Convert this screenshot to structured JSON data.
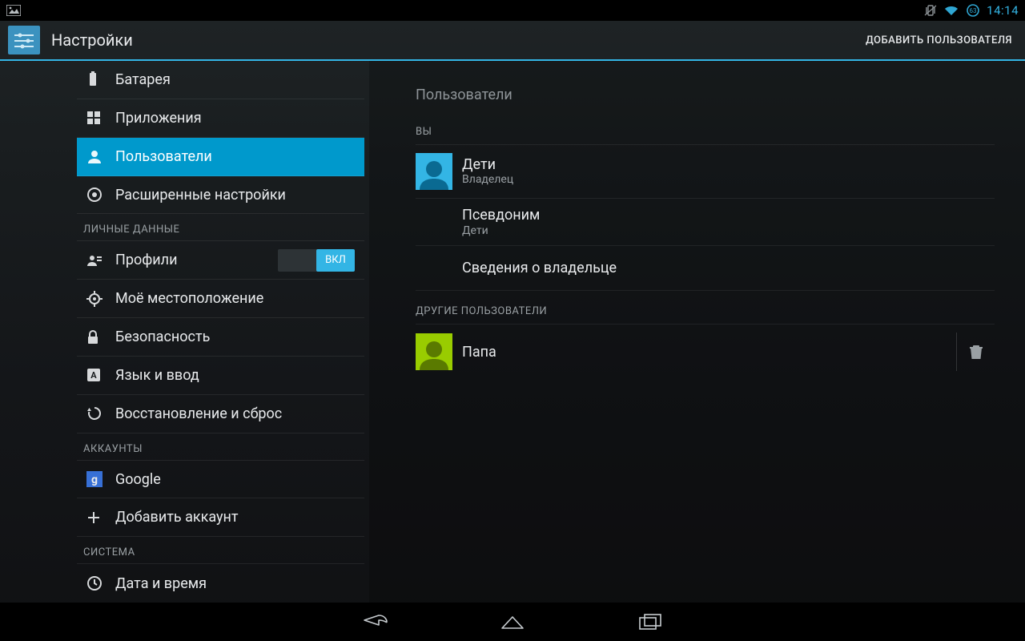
{
  "statusbar": {
    "time": "14:14"
  },
  "appbar": {
    "title": "Настройки",
    "action": "ДОБАВИТЬ ПОЛЬЗОВАТЕЛЯ"
  },
  "sidebar": {
    "items": [
      {
        "label": "Батарея"
      },
      {
        "label": "Приложения"
      },
      {
        "label": "Пользователи"
      },
      {
        "label": "Расширенные настройки"
      }
    ],
    "personal_header": "ЛИЧНЫЕ ДАННЫЕ",
    "personal": [
      {
        "label": "Профили",
        "switch": "ВКЛ"
      },
      {
        "label": "Моё местоположение"
      },
      {
        "label": "Безопасность"
      },
      {
        "label": "Язык и ввод"
      },
      {
        "label": "Восстановление и сброс"
      }
    ],
    "accounts_header": "АККАУНТЫ",
    "accounts": [
      {
        "label": "Google"
      },
      {
        "label": "Добавить аккаунт"
      }
    ],
    "system_header": "СИСТЕМА",
    "system": [
      {
        "label": "Дата и время"
      }
    ]
  },
  "content": {
    "title": "Пользователи",
    "you_header": "ВЫ",
    "owner": {
      "name": "Дети",
      "role": "Владелец"
    },
    "nickname": {
      "label": "Псевдоним",
      "value": "Дети"
    },
    "owner_info": "Сведения о владельце",
    "other_header": "ДРУГИЕ ПОЛЬЗОВАТЕЛИ",
    "other_user": {
      "name": "Папа"
    }
  }
}
